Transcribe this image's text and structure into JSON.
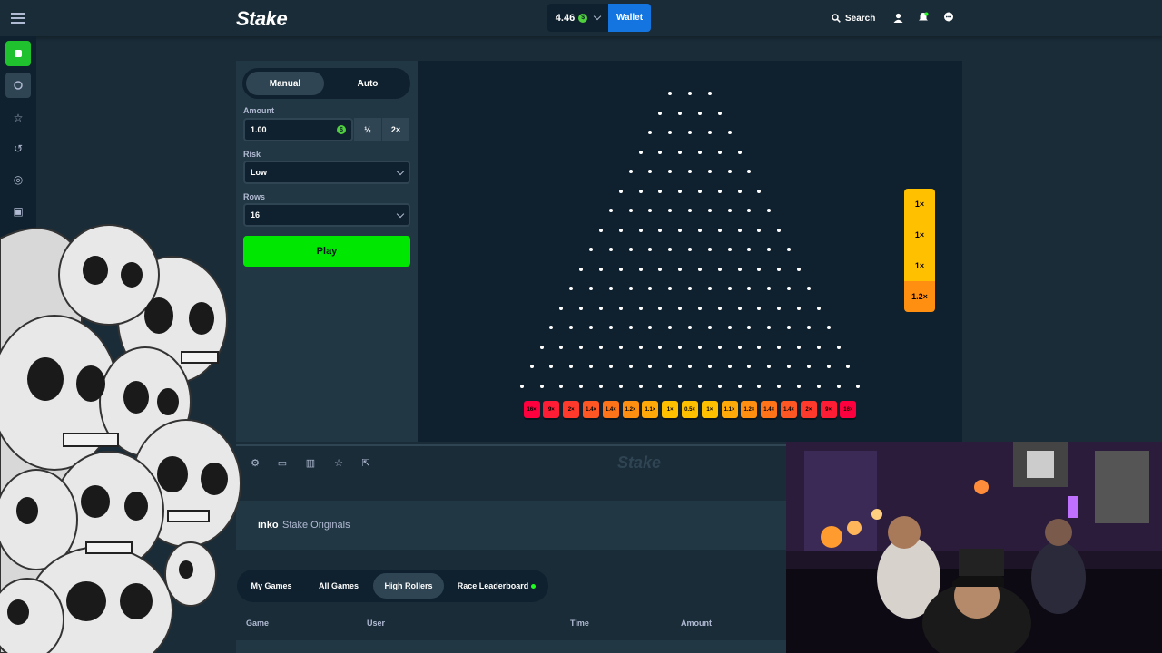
{
  "header": {
    "logo": "Stake",
    "balance": "4.46",
    "coin_symbol": "$",
    "wallet_label": "Wallet",
    "search_label": "Search"
  },
  "controls": {
    "tabs": [
      {
        "label": "Manual"
      },
      {
        "label": "Auto"
      }
    ],
    "amount_label": "Amount",
    "amount_value": "1.00",
    "half_label": "½",
    "double_label": "2×",
    "risk_label": "Risk",
    "risk_value": "Low",
    "rows_label": "Rows",
    "rows_value": "16",
    "play_label": "Play"
  },
  "board": {
    "rows": 16,
    "multipliers": [
      "16×",
      "9×",
      "2×",
      "1.4×",
      "1.4×",
      "1.2×",
      "1.1×",
      "1×",
      "0.5×",
      "1×",
      "1.1×",
      "1.2×",
      "1.4×",
      "1.4×",
      "2×",
      "9×",
      "16×"
    ],
    "bucket_colors": [
      "#ff003f",
      "#ff1d35",
      "#ff3a2c",
      "#ff5723",
      "#ff7419",
      "#ff8f10",
      "#ffaa08",
      "#ffc000",
      "#ffc000",
      "#ffc000",
      "#ffaa08",
      "#ff8f10",
      "#ff7419",
      "#ff5723",
      "#ff3a2c",
      "#ff1d35",
      "#ff003f"
    ],
    "history": [
      {
        "label": "1×",
        "color": "#ffc000"
      },
      {
        "label": "1×",
        "color": "#ffc000"
      },
      {
        "label": "1×",
        "color": "#ffc000"
      },
      {
        "label": "1.2×",
        "color": "#ff8f10"
      }
    ]
  },
  "game_info": {
    "watermark": "Stake",
    "name": "inko",
    "provider": "Stake Originals"
  },
  "bets": {
    "tabs": [
      {
        "label": "My Games"
      },
      {
        "label": "All Games"
      },
      {
        "label": "High Rollers"
      },
      {
        "label": "Race Leaderboard"
      }
    ],
    "columns": [
      "Game",
      "User",
      "Time",
      "Amount"
    ]
  },
  "icons": {
    "sidebar": [
      "casino-icon",
      "sports-icon",
      "favourites-icon",
      "recent-icon",
      "challenges-icon",
      "originals-icon",
      "sponsorships-icon"
    ],
    "toolbar": [
      "settings-icon",
      "theatre-mode-icon",
      "stats-icon",
      "favourite-icon",
      "popout-icon"
    ]
  }
}
